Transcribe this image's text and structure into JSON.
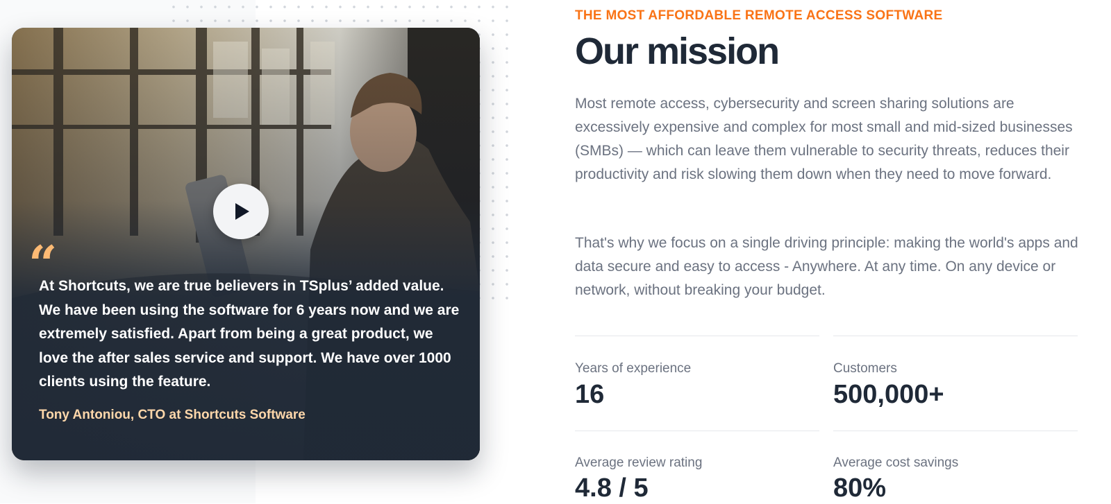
{
  "testimonial": {
    "quote": "At Shortcuts, we are true believers in TSplus’ added value. We have been using the software for 6 years now and we are extremely satisfied. Apart from being a great product, we love the after sales service and support. We have over 1000 clients using the feature.",
    "quote_mark": "“",
    "author": "Tony Antoniou, CTO at Shortcuts Software"
  },
  "mission": {
    "eyebrow": "THE MOST AFFORDABLE REMOTE ACCESS SOFTWARE",
    "title": "Our mission",
    "paragraphs": [
      "Most remote access, cybersecurity and screen sharing solutions are excessively expensive and complex for most small and mid-sized businesses (SMBs) — which can leave them vulnerable to security threats, reduces their productivity and risk slowing them down when they need to move forward.",
      "That's why we focus on a single driving principle: making the world's apps and data secure and easy to access - Anywhere. At any time. On any device or network, without breaking your budget."
    ]
  },
  "stats": [
    {
      "label": "Years of experience",
      "value": "16"
    },
    {
      "label": "Customers",
      "value": "500,000+"
    },
    {
      "label": "Average review rating",
      "value": "4.8 / 5"
    },
    {
      "label": "Average cost savings",
      "value": "80%"
    }
  ],
  "colors": {
    "accent": "#f97316",
    "heading": "#1f2937",
    "body_text": "#6b7280",
    "quote_author": "#fed7aa",
    "card_bg": "#1f2937"
  },
  "icons": {
    "play": "play-icon",
    "quote": "quote-icon"
  }
}
